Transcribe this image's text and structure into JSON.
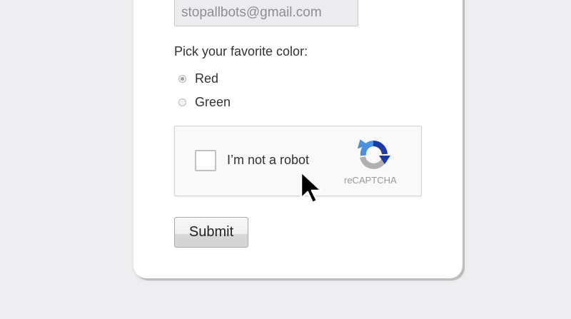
{
  "form": {
    "email_value": "stopallbots@gmail.com",
    "question": "Pick your favorite color:",
    "options": [
      {
        "label": "Red",
        "checked": true
      },
      {
        "label": "Green",
        "checked": false
      }
    ],
    "submit_label": "Submit"
  },
  "captcha": {
    "label": "I’m not a robot",
    "brand": "reCAPTCHA",
    "checked": false,
    "logo_icon": "recaptcha-logo-icon"
  },
  "cursor": {
    "icon": "mouse-pointer-icon"
  },
  "colors": {
    "background": "#eeeef0",
    "card": "#ffffff",
    "recaptcha_blue": "#1c3aa9",
    "recaptcha_light_blue": "#4a90e2",
    "recaptcha_gray": "#b0b0b0"
  }
}
